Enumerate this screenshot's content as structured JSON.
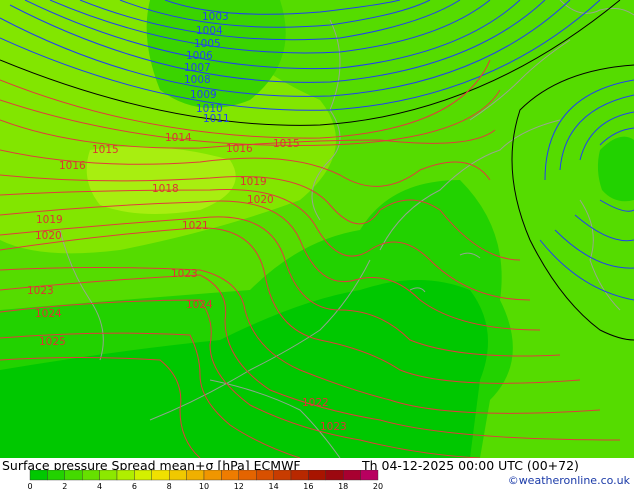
{
  "map": {
    "low_isobars": [
      "1003",
      "1004",
      "1005",
      "1006",
      "1007",
      "1008",
      "1009",
      "1010",
      "1011"
    ],
    "isobar_labels": [
      {
        "text": "1003",
        "color": "#2244ee"
      },
      {
        "text": "1004",
        "color": "#2244ee"
      },
      {
        "text": "1005",
        "color": "#2244ee"
      },
      {
        "text": "1006",
        "color": "#2244ee"
      },
      {
        "text": "1007",
        "color": "#2244ee"
      },
      {
        "text": "1008",
        "color": "#2244ee"
      },
      {
        "text": "1009",
        "color": "#2244ee"
      },
      {
        "text": "1010",
        "color": "#2244ee"
      },
      {
        "text": "1011",
        "color": "#2244ee"
      },
      {
        "text": "1014",
        "color": "#dd3333"
      },
      {
        "text": "1015",
        "color": "#dd3333"
      },
      {
        "text": "1016",
        "color": "#dd3333"
      },
      {
        "text": "1016",
        "color": "#dd3333"
      },
      {
        "text": "1015",
        "color": "#dd3333"
      },
      {
        "text": "1018",
        "color": "#dd3333"
      },
      {
        "text": "1019",
        "color": "#dd3333"
      },
      {
        "text": "1020",
        "color": "#dd3333"
      },
      {
        "text": "1019",
        "color": "#dd3333"
      },
      {
        "text": "1020",
        "color": "#dd3333"
      },
      {
        "text": "1021",
        "color": "#dd3333"
      },
      {
        "text": "1023",
        "color": "#dd3333"
      },
      {
        "text": "1023",
        "color": "#dd3333"
      },
      {
        "text": "1024",
        "color": "#dd3333"
      },
      {
        "text": "1024",
        "color": "#dd3333"
      },
      {
        "text": "1025",
        "color": "#dd3333"
      },
      {
        "text": "1022",
        "color": "#dd3333"
      },
      {
        "text": "1023",
        "color": "#dd3333"
      }
    ],
    "colors": {
      "spread_0_1": "#00c800",
      "spread_1_2": "#22d200",
      "spread_2_3": "#55dc00",
      "spread_3_4": "#82e600",
      "high_isobar": "#e03c3c",
      "low_isobar": "#2040f0",
      "ref_isobar": "#000000",
      "coastline": "#a0a0a0"
    }
  },
  "title": {
    "left": "Surface pressure Spread mean+σ [hPa] ECMWF",
    "right": "Th 04-12-2025 00:00 UTC (00+72)"
  },
  "colorbar": {
    "ticks": [
      "0",
      "2",
      "4",
      "6",
      "8",
      "10",
      "12",
      "14",
      "16",
      "18",
      "20"
    ],
    "colors": [
      "#00c800",
      "#22d200",
      "#44da00",
      "#66e000",
      "#8ce800",
      "#b0ee00",
      "#d4f000",
      "#f0e000",
      "#f0c800",
      "#f0b000",
      "#f09600",
      "#ee7c00",
      "#e46400",
      "#d85000",
      "#c83c00",
      "#b82800",
      "#a81400",
      "#9c0810",
      "#a80030",
      "#b80060"
    ]
  },
  "copyright": "©weatheronline.co.uk"
}
